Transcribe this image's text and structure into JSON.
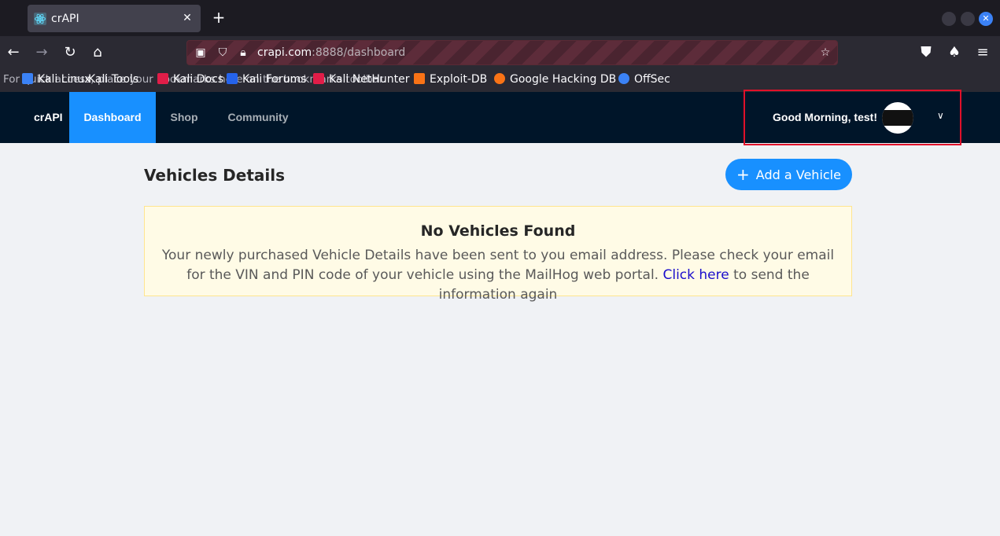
{
  "browser": {
    "tab_title": "crAPI",
    "url_host": "crapi.com",
    "url_rest": ":8888/dashboard",
    "bookmarks_overlapped_text": "For quick access, place your bookmarks here on the bookmarks toolbar.",
    "bookmarks": [
      {
        "label": "Kali Linux",
        "color": "#3b82f6"
      },
      {
        "label": "Kali Tools",
        "color": "#e11d48"
      },
      {
        "label": "Kali Docs",
        "color": "#2563eb"
      },
      {
        "label": "Kali Forums",
        "color": "#d1d5db"
      },
      {
        "label": "Kali NetHunter",
        "color": "#e11d48"
      },
      {
        "label": "Exploit-DB",
        "color": "#f97316"
      },
      {
        "label": "Google Hacking DB",
        "color": "#f97316"
      },
      {
        "label": "OffSec",
        "color": "#3b82f6"
      }
    ]
  },
  "app": {
    "brand": "crAPI",
    "menu": [
      "Dashboard",
      "Shop",
      "Community"
    ],
    "active_menu": "Dashboard",
    "greeting": "Good Morning, test!",
    "accent": "#1890ff",
    "nav_bg": "#001529"
  },
  "main": {
    "section_title": "Vehicles Details",
    "add_button": "Add a Vehicle",
    "alert_title": "No Vehicles Found",
    "alert_text_before": "Your newly purchased Vehicle Details have been sent to you email address. Please check your email for the VIN and PIN code of your vehicle using the MailHog web portal.",
    "alert_link": "Click here",
    "alert_text_after": "to send the information again"
  }
}
